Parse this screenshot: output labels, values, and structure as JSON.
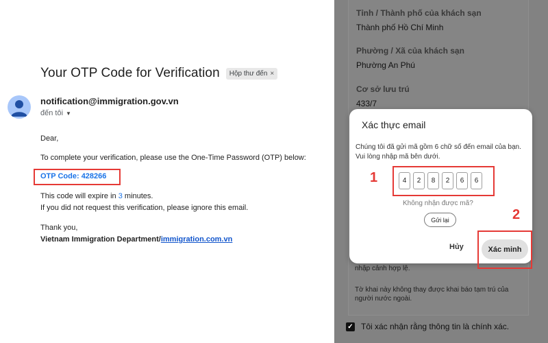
{
  "email": {
    "subject": "Your OTP Code for Verification",
    "label_chip": "Hộp thư đến",
    "label_chip_close": "×",
    "sender": "notification@immigration.gov.vn",
    "recipient": "đến tôi",
    "greeting": "Dear,",
    "intro": "To complete your verification, please use the One-Time Password (OTP) below:",
    "otp_line": "OTP Code: 428266",
    "expire_prefix": "This code will expire in ",
    "expire_minutes": "3",
    "expire_suffix": " minutes.",
    "ignore_line": "If you did not request this verification, please ignore this email.",
    "thanks": "Thank you,",
    "signature": "Vietnam Immigration Department/",
    "signature_link": "immigration.com.vn"
  },
  "form": {
    "province_label": "Tỉnh / Thành phố của khách sạn",
    "province_value": "Thành phố Hồ Chí Minh",
    "ward_label": "Phường / Xã của khách sạn",
    "ward_value": "Phường An Phú",
    "lodging_label": "Cơ sở lưu trú",
    "lodging_value": "433/7",
    "note_1": "nhập cảnh hợp lệ.",
    "note_2": "Tờ khai này không thay được khai báo tạm trú của người nước ngoài.",
    "confirm_label": "Tôi xác nhận rằng thông tin là chính xác.",
    "confirm_checked": true
  },
  "dialog": {
    "title": "Xác thực email",
    "description": "Chúng tôi đã gửi mã gồm 6 chữ số đến email của bạn. Vui lòng nhập mã bên dưới.",
    "otp_digits": [
      "4",
      "2",
      "8",
      "2",
      "6",
      "6"
    ],
    "resend_question": "Không nhận được mã?",
    "resend_button": "Gửi lại",
    "cancel_button": "Hủy",
    "verify_button": "Xác minh"
  },
  "annotations": {
    "step_1": "1",
    "step_2": "2",
    "highlight_color": "#e53935"
  },
  "colors": {
    "accent_blue": "#1a73e8",
    "overlay_gray": "#828282"
  }
}
